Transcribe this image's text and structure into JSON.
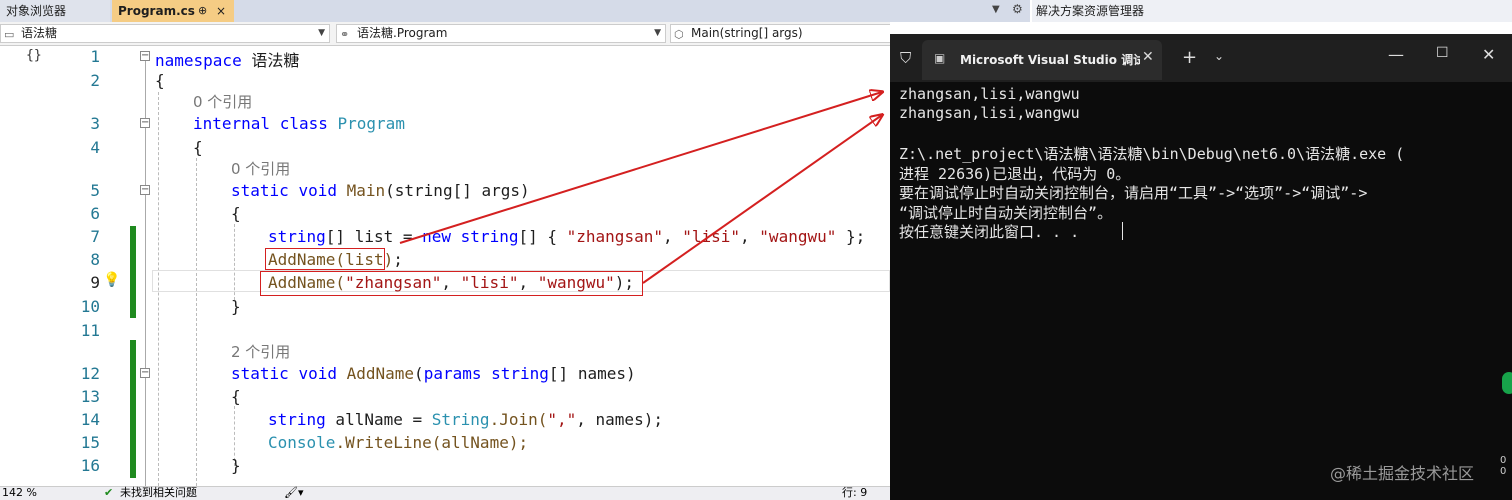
{
  "tabs": {
    "object_browser": "对象浏览器",
    "active_file": "Program.cs",
    "pin_glyph": "⊕",
    "close_glyph": "×"
  },
  "solution_explorer": {
    "title": "解决方案资源管理器"
  },
  "navbar": {
    "project": "语法糖",
    "class": "语法糖.Program",
    "member": "Main(string[] args)"
  },
  "editor": {
    "line_numbers": [
      "1",
      "2",
      "3",
      "4",
      "5",
      "6",
      "7",
      "8",
      "9",
      "10",
      "11",
      "12",
      "13",
      "14",
      "15",
      "16"
    ],
    "codelens": {
      "class_refs": "0 个引用",
      "main_refs": "0 个引用",
      "addname_refs": "2 个引用"
    },
    "lines": {
      "namespace_kw": "namespace",
      "namespace_name": "语法糖",
      "open_brace": "{",
      "close_brace": "}",
      "internal_kw": "internal",
      "class_kw": "class",
      "class_name": "Program",
      "static_kw": "static",
      "void_kw": "void",
      "main_name": "Main",
      "main_params": "(string[] args)",
      "l7_type": "string",
      "l7_decl": "[] list = ",
      "l7_new": "new",
      "l7_type2": "string",
      "l7_open": "[] { ",
      "l7_s1": "\"zhangsan\"",
      "l7_sep1": ", ",
      "l7_s2": "\"lisi\"",
      "l7_sep2": ", ",
      "l7_s3": "\"wangwu\"",
      "l7_end": " };",
      "l8_call": "AddName(list)",
      "l8_end": ";",
      "l9_call": "AddName(",
      "l9_s1": "\"zhangsan\"",
      "l9_sep1": ", ",
      "l9_s2": "\"lisi\"",
      "l9_sep2": ", ",
      "l9_s3": "\"wangwu\"",
      "l9_end": ");",
      "l12_name": "AddName",
      "l12_params_open": "(",
      "l12_params_kw": "params",
      "l12_type": "string",
      "l12_params_rest": "[] names)",
      "l14_type": "string",
      "l14_mid": " allName = ",
      "l14_cls": "String",
      "l14_join": ".Join(",
      "l14_str": "\",\"",
      "l14_rest": ", names);",
      "l15_cls": "Console",
      "l15_rest": ".WriteLine(allName);"
    }
  },
  "console": {
    "title": "Microsoft Visual Studio 调试控",
    "output": [
      "zhangsan,lisi,wangwu",
      "zhangsan,lisi,wangwu",
      "",
      "Z:\\.net_project\\语法糖\\语法糖\\bin\\Debug\\net6.0\\语法糖.exe (",
      "进程 22636)已退出，代码为 0。",
      "要在调试停止时自动关闭控制台，请启用“工具”->“选项”->“调试”->",
      "“调试停止时自动关闭控制台”。",
      "按任意键关闭此窗口. . ."
    ],
    "plus_glyph": "+",
    "dropdown_glyph": "⌄",
    "min_glyph": "—",
    "max_glyph": "☐",
    "close_glyph": "✕"
  },
  "status": {
    "zoom": "142 %",
    "message": "未找到相关问题",
    "position": "行: 9"
  },
  "watermark": "@稀土掘金技术社区",
  "side_digits": "0\n0",
  "colors": {
    "keyword": "#0000ff",
    "type": "#2b91af",
    "string": "#a31515",
    "annotation_red": "#d42020",
    "change_bar": "#1f8a1f",
    "console_bg": "#0c0c0c"
  }
}
